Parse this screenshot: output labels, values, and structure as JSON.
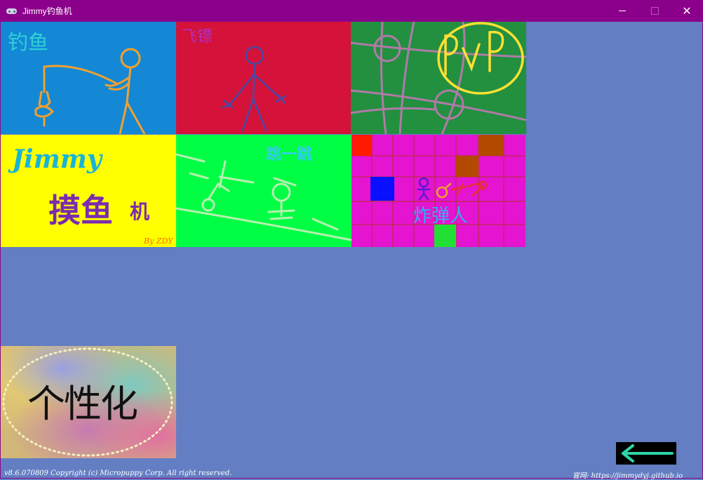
{
  "window": {
    "title": "Jimmy钓鱼机",
    "app_icon": "gamepad-icon",
    "minimize_icon": "minimize-icon",
    "maximize_icon": "maximize-icon",
    "close_icon": "close-icon",
    "close_glyph": "✕",
    "title_bar_color": "#8b008b",
    "background_color": "#637ec2"
  },
  "tiles": {
    "fishing": {
      "label": "钓鱼",
      "color": "#1488d4"
    },
    "darts": {
      "label": "飞镖",
      "color": "#d4123a"
    },
    "pvp": {
      "label": "PvP",
      "color": "#22903f"
    },
    "logo": {
      "line1": "Jimmy",
      "line2": "摸鱼",
      "line3": "机",
      "byline": "By ZDY",
      "color": "#ffff00"
    },
    "jump": {
      "label": "跳一跳",
      "color": "#00ff44"
    },
    "bomberman": {
      "label": "炸弹人",
      "color": "#e414d0"
    },
    "customize": {
      "label": "个性化"
    }
  },
  "back_button": {
    "icon": "arrow-left-icon",
    "color": "#2fd3a8"
  },
  "footer": {
    "copyright": "v8.6.070809 Copyright (c) Micropuppy Corp. All right reserved.",
    "website": "官网: https://jimmydyj.github.io"
  }
}
